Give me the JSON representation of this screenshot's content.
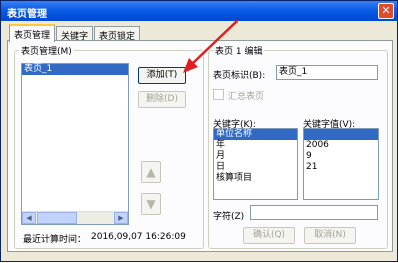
{
  "window": {
    "title": "表页管理",
    "close_label": "✕"
  },
  "tabs": [
    {
      "label": "表页管理"
    },
    {
      "label": "关键字"
    },
    {
      "label": "表页锁定"
    }
  ],
  "sheet_group": {
    "legend": "表页管理(M)",
    "sheets": [
      "表页_1"
    ],
    "selected_index": 0,
    "add_button": "添加(T)",
    "delete_button": "删除(D)",
    "last_calc_label": "最近计算时间：",
    "last_calc_value": "2016,09,07 16:26:09"
  },
  "edit_group": {
    "legend": "表页 1 编辑",
    "sheet_id_label": "表页标识(B):",
    "sheet_id_value": "表页_1",
    "summary_checkbox_label": "汇总表页",
    "summary_checked": false,
    "keyword_label": "关键字(K):",
    "keywords": [
      "单位名称",
      "年",
      "月",
      "日",
      "核算项目"
    ],
    "keyword_selected_index": 0,
    "value_label": "关键字值(V):",
    "values": [
      "",
      "2006",
      "9",
      "21",
      ""
    ],
    "char_label": "字符(Z)",
    "char_value": "",
    "confirm_button": "确认(Q)",
    "cancel_button": "取消(N)"
  },
  "icons": {
    "move_up": "up-arrow-icon",
    "move_down": "down-arrow-icon",
    "scroll_left": "left-arrow-icon",
    "scroll_right": "right-arrow-icon"
  },
  "colors": {
    "title_bar": "#0a5ce6",
    "selection": "#316ac5",
    "annotation_arrow": "#e02020"
  }
}
